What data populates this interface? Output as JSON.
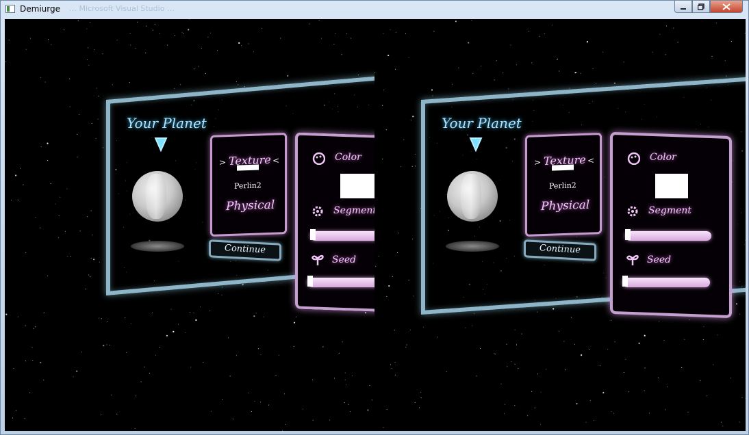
{
  "window": {
    "title": "Demiurge",
    "ghost_title": "…  Microsoft Visual Studio …"
  },
  "ui": {
    "heading": "Your Planet",
    "texture_label": "Texture",
    "arrow_left": ">",
    "arrow_right": "<",
    "noise_name": "Perlin2",
    "physical_label": "Physical",
    "continue_label": "Continue",
    "color_label": "Color",
    "segment_label": "Segment",
    "seed_label": "Seed",
    "segment_value": 0.0,
    "seed_value": 0.0,
    "swatch_color": "#ffffff"
  },
  "colors": {
    "frame_cyan": "#8fb6c8",
    "panel_pink": "#c79ad0",
    "heading_blue": "#a8e3ff"
  }
}
